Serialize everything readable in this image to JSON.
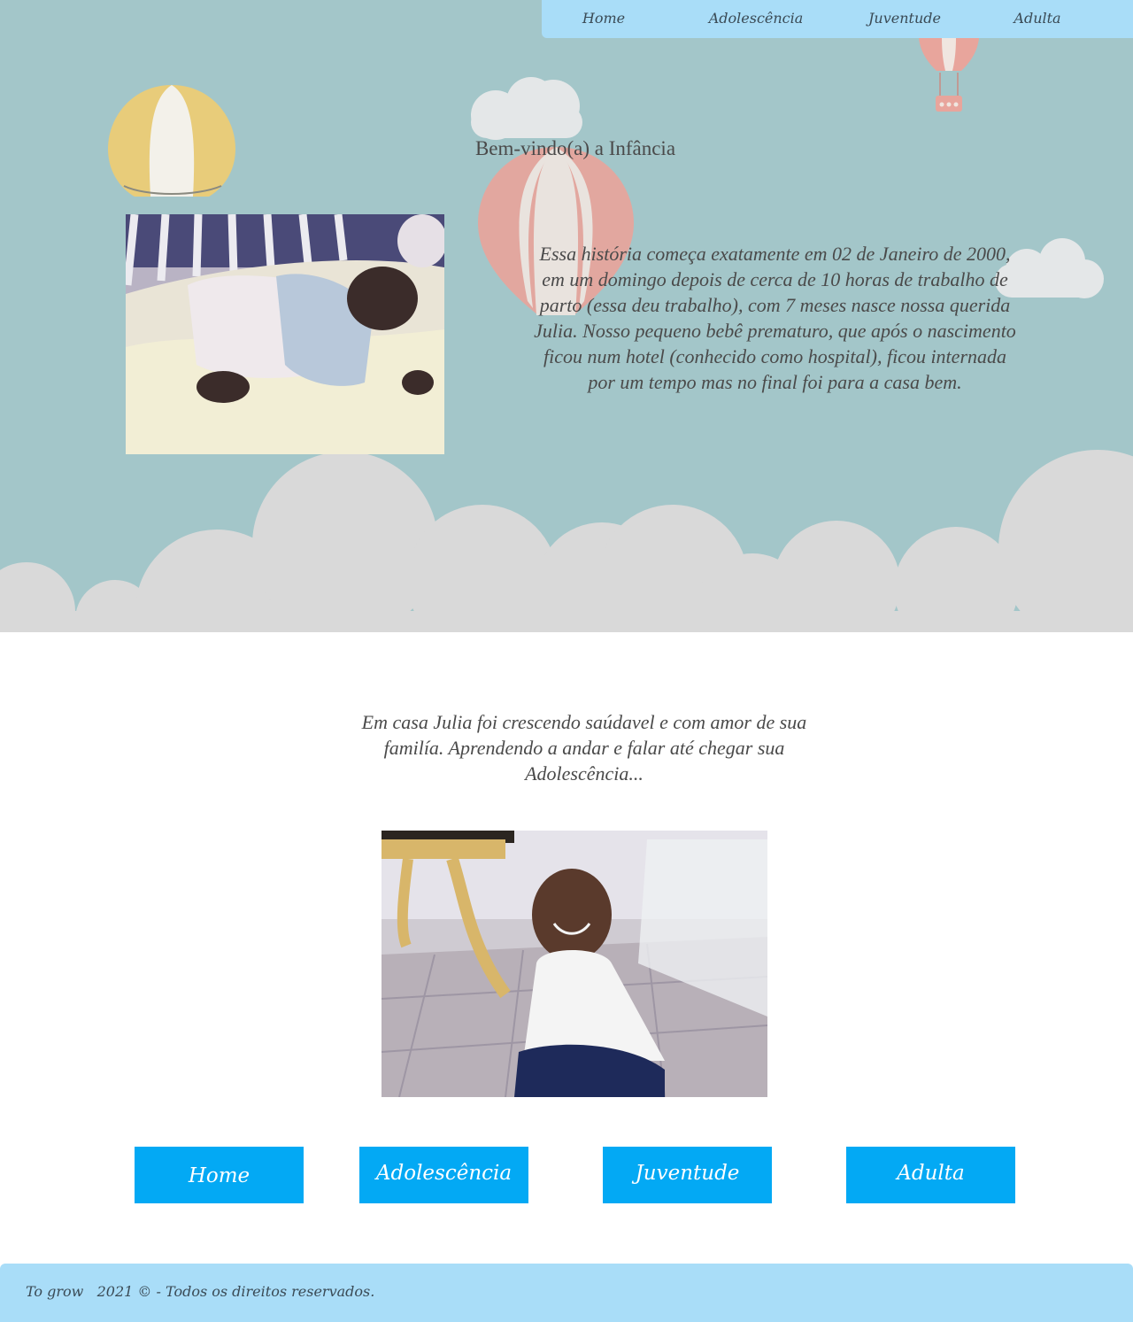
{
  "nav": {
    "items": [
      {
        "label": "Home"
      },
      {
        "label": "Adolescência"
      },
      {
        "label": "Juventude"
      },
      {
        "label": "Adulta"
      }
    ]
  },
  "hero": {
    "title": "Bem-vindo(a) a Infância",
    "text": "Essa história começa exatamente em 02 de Janeiro de 2000, em um domingo depois de cerca de 10 horas de trabalho de parto (essa deu trabalho), com 7 meses nasce nossa querida Julia. Nosso pequeno bebê prematuro, que após o nascimento ficou num hotel (conhecido como hospital), ficou internada por um tempo mas no final foi para a casa bem."
  },
  "middle": {
    "text": "Em casa Julia foi crescendo saúdavel e com amor de sua familía. Aprendendo a andar e falar até chegar sua Adolescência..."
  },
  "bottom_nav": {
    "buttons": [
      {
        "label": "Home"
      },
      {
        "label": "Adolescência"
      },
      {
        "label": "Juventude"
      },
      {
        "label": "Adulta"
      }
    ]
  },
  "footer": {
    "text": "To grow   2021 © - Todos os direitos reservados."
  },
  "colors": {
    "hero_background": "#a3c6c9",
    "cloud": "#d9d9d9",
    "nav_background": "#a9ddf8",
    "button": "#03a9f4",
    "balloon_yellow": "#e8cc7a",
    "balloon_pink": "#e8a59c"
  }
}
